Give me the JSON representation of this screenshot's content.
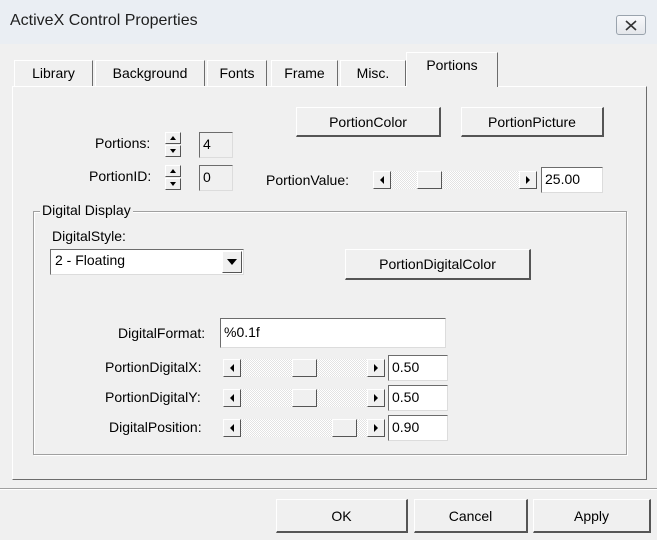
{
  "window": {
    "title": "ActiveX Control Properties"
  },
  "tabs": [
    {
      "label": "Library"
    },
    {
      "label": "Background"
    },
    {
      "label": "Fonts"
    },
    {
      "label": "Frame"
    },
    {
      "label": "Misc."
    },
    {
      "label": "Portions"
    }
  ],
  "active_tab": "Portions",
  "portions": {
    "portions_label": "Portions:",
    "portions_value": "4",
    "portion_id_label": "PortionID:",
    "portion_id_value": "0",
    "portion_color_button": "PortionColor",
    "portion_picture_button": "PortionPicture",
    "portion_value_label": "PortionValue:",
    "portion_value": "25.00",
    "portion_value_level": 0.25
  },
  "digital_display": {
    "group_title": "Digital Display",
    "style_label": "DigitalStyle:",
    "style_value": "2 - Floating",
    "digital_color_button": "PortionDigitalColor",
    "format_label": "DigitalFormat:",
    "format_value": "%0.1f",
    "digital_x_label": "PortionDigitalX:",
    "digital_x_value": "0.50",
    "digital_x_level": 0.5,
    "digital_y_label": "PortionDigitalY:",
    "digital_y_value": "0.50",
    "digital_y_level": 0.5,
    "position_label": "DigitalPosition:",
    "position_value": "0.90",
    "position_level": 0.9
  },
  "footer": {
    "ok": "OK",
    "cancel": "Cancel",
    "apply": "Apply"
  }
}
